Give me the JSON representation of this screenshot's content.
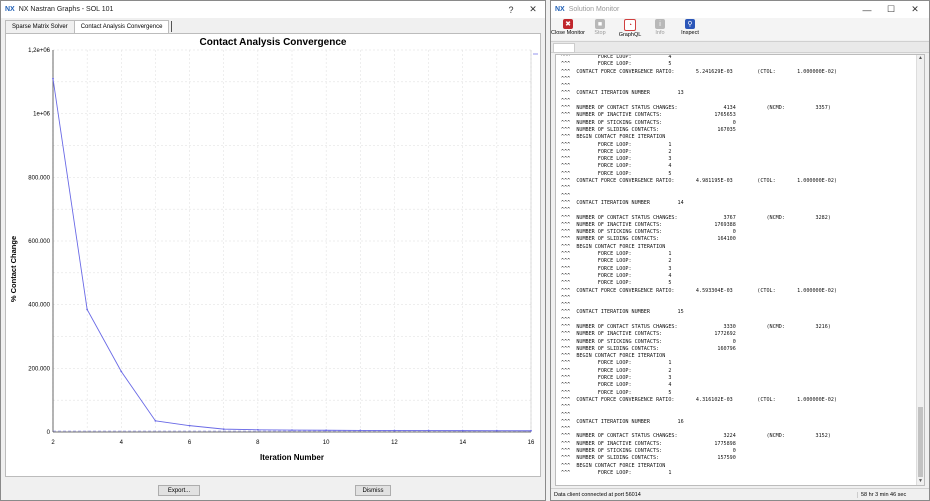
{
  "graphs_window": {
    "logo": "NX",
    "title": "NX Nastran Graphs - SOL 101",
    "help_label": "?",
    "close_label": "✕",
    "tabs": [
      {
        "label": "Sparse Matrix Solver",
        "active": false
      },
      {
        "label": "Contact Analysis Convergence",
        "active": true
      }
    ],
    "export_label": "Export...",
    "dismiss_label": "Dismiss"
  },
  "chart_data": {
    "type": "line",
    "title": "Contact Analysis Convergence",
    "xlabel": "Iteration Number",
    "ylabel": "% Contact Change",
    "xlim": [
      2,
      16
    ],
    "ylim": [
      0,
      1200000
    ],
    "x_ticks": [
      2,
      4,
      6,
      8,
      10,
      12,
      14,
      16
    ],
    "y_ticks": [
      {
        "value": 0,
        "label": "0"
      },
      {
        "value": 200000,
        "label": "200.000"
      },
      {
        "value": 400000,
        "label": "400.000"
      },
      {
        "value": 600000,
        "label": "600.000"
      },
      {
        "value": 800000,
        "label": "800.000"
      },
      {
        "value": 1000000,
        "label": "1e+06"
      },
      {
        "value": 1200000,
        "label": "1,2e+06"
      }
    ],
    "grid": true,
    "series": [
      {
        "color": "#6a6ae6",
        "x": [
          2,
          3,
          4,
          5,
          6,
          7,
          8,
          9,
          10,
          11,
          12,
          13,
          14,
          15,
          16
        ],
        "y": [
          1110000,
          385000,
          190000,
          35000,
          20000,
          9000,
          7000,
          6000,
          5500,
          5000,
          4800,
          4500,
          4300,
          4100,
          3900
        ]
      }
    ]
  },
  "monitor_window": {
    "logo": "NX",
    "title": "Solution Monitor",
    "minimize_label": "—",
    "maximize_label": "☐",
    "close_label": "✕",
    "tools": [
      {
        "label": "Close Monitor",
        "icon": "close-monitor-icon",
        "color": "#c0262c",
        "glyph": "✖",
        "enabled": true
      },
      {
        "label": "Stop",
        "icon": "stop-icon",
        "color": "#b8b8b8",
        "glyph": "■",
        "enabled": false
      },
      {
        "label": "GraphQL",
        "icon": "graph-icon",
        "color": "#d04040",
        "glyph": "◔",
        "enabled": true
      },
      {
        "label": "Info",
        "icon": "info-icon",
        "color": "#b8b8b8",
        "glyph": "i",
        "enabled": false
      },
      {
        "label": "Inspect",
        "icon": "inspect-icon",
        "color": "#2b56b8",
        "glyph": "⚲",
        "enabled": true
      }
    ],
    "status_left": "Data client connected at port 56014",
    "status_right": "58 hr 3 min 46 sec"
  },
  "log_lines": [
    "^^^         FORCE LOOP:            4",
    "^^^         FORCE LOOP:            5",
    "^^^  CONTACT FORCE CONVERGENCE RATIO:       5.241629E-03        (CTOL:       1.000000E-02)",
    "^^^",
    "^^^",
    "^^^  CONTACT ITERATION NUMBER         13",
    "^^^",
    "^^^  NUMBER OF CONTACT STATUS CHANGES:               4134          (NCMD:          3357)",
    "^^^  NUMBER OF INACTIVE CONTACTS:                 1765653",
    "^^^  NUMBER OF STICKING CONTACTS:                       0",
    "^^^  NUMBER OF SLIDING CONTACTS:                   167035",
    "^^^  BEGIN CONTACT FORCE ITERATION",
    "^^^         FORCE LOOP:            1",
    "^^^         FORCE LOOP:            2",
    "^^^         FORCE LOOP:            3",
    "^^^         FORCE LOOP:            4",
    "^^^         FORCE LOOP:            5",
    "^^^  CONTACT FORCE CONVERGENCE RATIO:       4.981195E-03        (CTOL:       1.000000E-02)",
    "^^^",
    "^^^",
    "^^^  CONTACT ITERATION NUMBER         14",
    "^^^",
    "^^^  NUMBER OF CONTACT STATUS CHANGES:               3767          (NCMD:          3282)",
    "^^^  NUMBER OF INACTIVE CONTACTS:                 1769388",
    "^^^  NUMBER OF STICKING CONTACTS:                       0",
    "^^^  NUMBER OF SLIDING CONTACTS:                   164100",
    "^^^  BEGIN CONTACT FORCE ITERATION",
    "^^^         FORCE LOOP:            1",
    "^^^         FORCE LOOP:            2",
    "^^^         FORCE LOOP:            3",
    "^^^         FORCE LOOP:            4",
    "^^^         FORCE LOOP:            5",
    "^^^  CONTACT FORCE CONVERGENCE RATIO:       4.593304E-03        (CTOL:       1.000000E-02)",
    "^^^",
    "^^^",
    "^^^  CONTACT ITERATION NUMBER         15",
    "^^^",
    "^^^  NUMBER OF CONTACT STATUS CHANGES:               3330          (NCMD:          3216)",
    "^^^  NUMBER OF INACTIVE CONTACTS:                 1772692",
    "^^^  NUMBER OF STICKING CONTACTS:                       0",
    "^^^  NUMBER OF SLIDING CONTACTS:                   160796",
    "^^^  BEGIN CONTACT FORCE ITERATION",
    "^^^         FORCE LOOP:            1",
    "^^^         FORCE LOOP:            2",
    "^^^         FORCE LOOP:            3",
    "^^^         FORCE LOOP:            4",
    "^^^         FORCE LOOP:            5",
    "^^^  CONTACT FORCE CONVERGENCE RATIO:       4.316102E-03        (CTOL:       1.000000E-02)",
    "^^^",
    "^^^",
    "^^^  CONTACT ITERATION NUMBER         16",
    "^^^",
    "^^^  NUMBER OF CONTACT STATUS CHANGES:               3224          (NCMD:          3152)",
    "^^^  NUMBER OF INACTIVE CONTACTS:                 1775898",
    "^^^  NUMBER OF STICKING CONTACTS:                       0",
    "^^^  NUMBER OF SLIDING CONTACTS:                   157590",
    "^^^  BEGIN CONTACT FORCE ITERATION",
    "^^^         FORCE LOOP:            1"
  ]
}
